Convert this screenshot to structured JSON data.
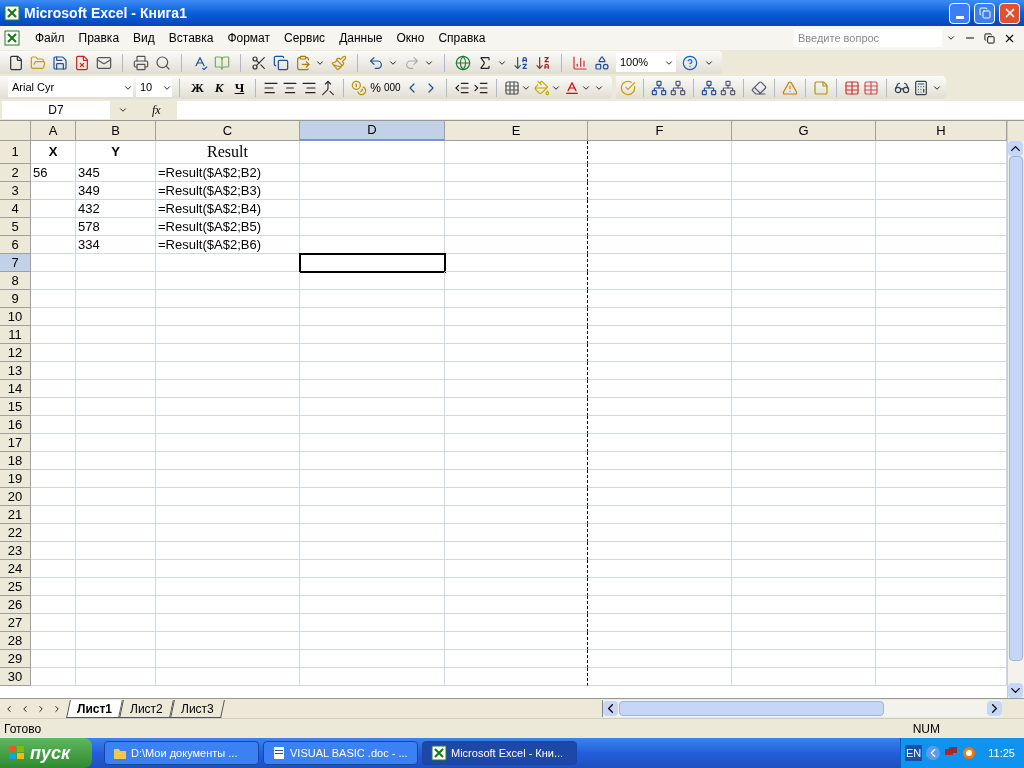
{
  "window": {
    "title": "Microsoft Excel - Книга1"
  },
  "menu": [
    "Файл",
    "Правка",
    "Вид",
    "Вставка",
    "Формат",
    "Сервис",
    "Данные",
    "Окно",
    "Справка"
  ],
  "help_box": {
    "placeholder": "Введите вопрос"
  },
  "standard_toolbar": {
    "zoom": "100%"
  },
  "format_toolbar": {
    "font": "Arial Cyr",
    "size": "10",
    "bold": "Ж",
    "italic": "К",
    "underline": "Ч",
    "percent": "%",
    "thousands": "000"
  },
  "formula_bar": {
    "name_box": "D7",
    "fx": "fx"
  },
  "columns": [
    {
      "label": "A",
      "selected": false
    },
    {
      "label": "B",
      "selected": false
    },
    {
      "label": "C",
      "selected": false
    },
    {
      "label": "D",
      "selected": true
    },
    {
      "label": "E",
      "selected": false
    },
    {
      "label": "F",
      "selected": false
    },
    {
      "label": "G",
      "selected": false
    },
    {
      "label": "H",
      "selected": false
    }
  ],
  "rows": [
    {
      "number": "1",
      "kind": "heading",
      "selected": false,
      "cells": [
        "X",
        "Y",
        "Result"
      ]
    },
    {
      "number": "2",
      "kind": "data",
      "selected": false,
      "cells": [
        "56",
        "345",
        "=Result($A$2;B2)"
      ]
    },
    {
      "number": "3",
      "kind": "data",
      "selected": false,
      "cells": [
        "",
        "349",
        "=Result($A$2;B3)"
      ]
    },
    {
      "number": "4",
      "kind": "data",
      "selected": false,
      "cells": [
        "",
        "432",
        "=Result($A$2;B4)"
      ]
    },
    {
      "number": "5",
      "kind": "data",
      "selected": false,
      "cells": [
        "",
        "578",
        "=Result($A$2;B5)"
      ]
    },
    {
      "number": "6",
      "kind": "data",
      "selected": false,
      "cells": [
        "",
        "334",
        "=Result($A$2;B6)"
      ]
    },
    {
      "number": "7",
      "kind": "data",
      "selected": true,
      "cells": []
    },
    {
      "number": "8",
      "kind": "data",
      "selected": false,
      "cells": []
    },
    {
      "number": "9",
      "kind": "data",
      "selected": false,
      "cells": []
    },
    {
      "number": "10",
      "kind": "data",
      "selected": false,
      "cells": []
    },
    {
      "number": "11",
      "kind": "data",
      "selected": false,
      "cells": []
    },
    {
      "number": "12",
      "kind": "data",
      "selected": false,
      "cells": []
    },
    {
      "number": "13",
      "kind": "data",
      "selected": false,
      "cells": []
    },
    {
      "number": "14",
      "kind": "data",
      "selected": false,
      "cells": []
    },
    {
      "number": "15",
      "kind": "data",
      "selected": false,
      "cells": []
    },
    {
      "number": "16",
      "kind": "data",
      "selected": false,
      "cells": []
    },
    {
      "number": "17",
      "kind": "data",
      "selected": false,
      "cells": []
    },
    {
      "number": "18",
      "kind": "data",
      "selected": false,
      "cells": []
    },
    {
      "number": "19",
      "kind": "data",
      "selected": false,
      "cells": []
    },
    {
      "number": "20",
      "kind": "data",
      "selected": false,
      "cells": []
    },
    {
      "number": "21",
      "kind": "data",
      "selected": false,
      "cells": []
    },
    {
      "number": "22",
      "kind": "data",
      "selected": false,
      "cells": []
    },
    {
      "number": "23",
      "kind": "data",
      "selected": false,
      "cells": []
    },
    {
      "number": "24",
      "kind": "data",
      "selected": false,
      "cells": []
    },
    {
      "number": "25",
      "kind": "data",
      "selected": false,
      "cells": []
    },
    {
      "number": "26",
      "kind": "data",
      "selected": false,
      "cells": []
    },
    {
      "number": "27",
      "kind": "data",
      "selected": false,
      "cells": []
    },
    {
      "number": "28",
      "kind": "data",
      "selected": false,
      "cells": []
    },
    {
      "number": "29",
      "kind": "data",
      "selected": false,
      "cells": []
    },
    {
      "number": "30",
      "kind": "data",
      "selected": false,
      "cells": []
    }
  ],
  "sheet_tabs": [
    {
      "label": "Лист1",
      "selected": true
    },
    {
      "label": "Лист2",
      "selected": false
    },
    {
      "label": "Лист3",
      "selected": false
    }
  ],
  "status_bar": {
    "status": "Готово",
    "num": "NUM"
  },
  "taskbar": {
    "start": "пуск",
    "tasks": [
      {
        "label": "D:\\Мои документы ...",
        "selected": false,
        "kind": "folder"
      },
      {
        "label": "VISUAL BASIC .doc - ...",
        "selected": false,
        "kind": "word"
      },
      {
        "label": "Microsoft Excel - Кни...",
        "selected": true,
        "kind": "excel"
      }
    ],
    "language": "EN",
    "clock": "11:25"
  }
}
